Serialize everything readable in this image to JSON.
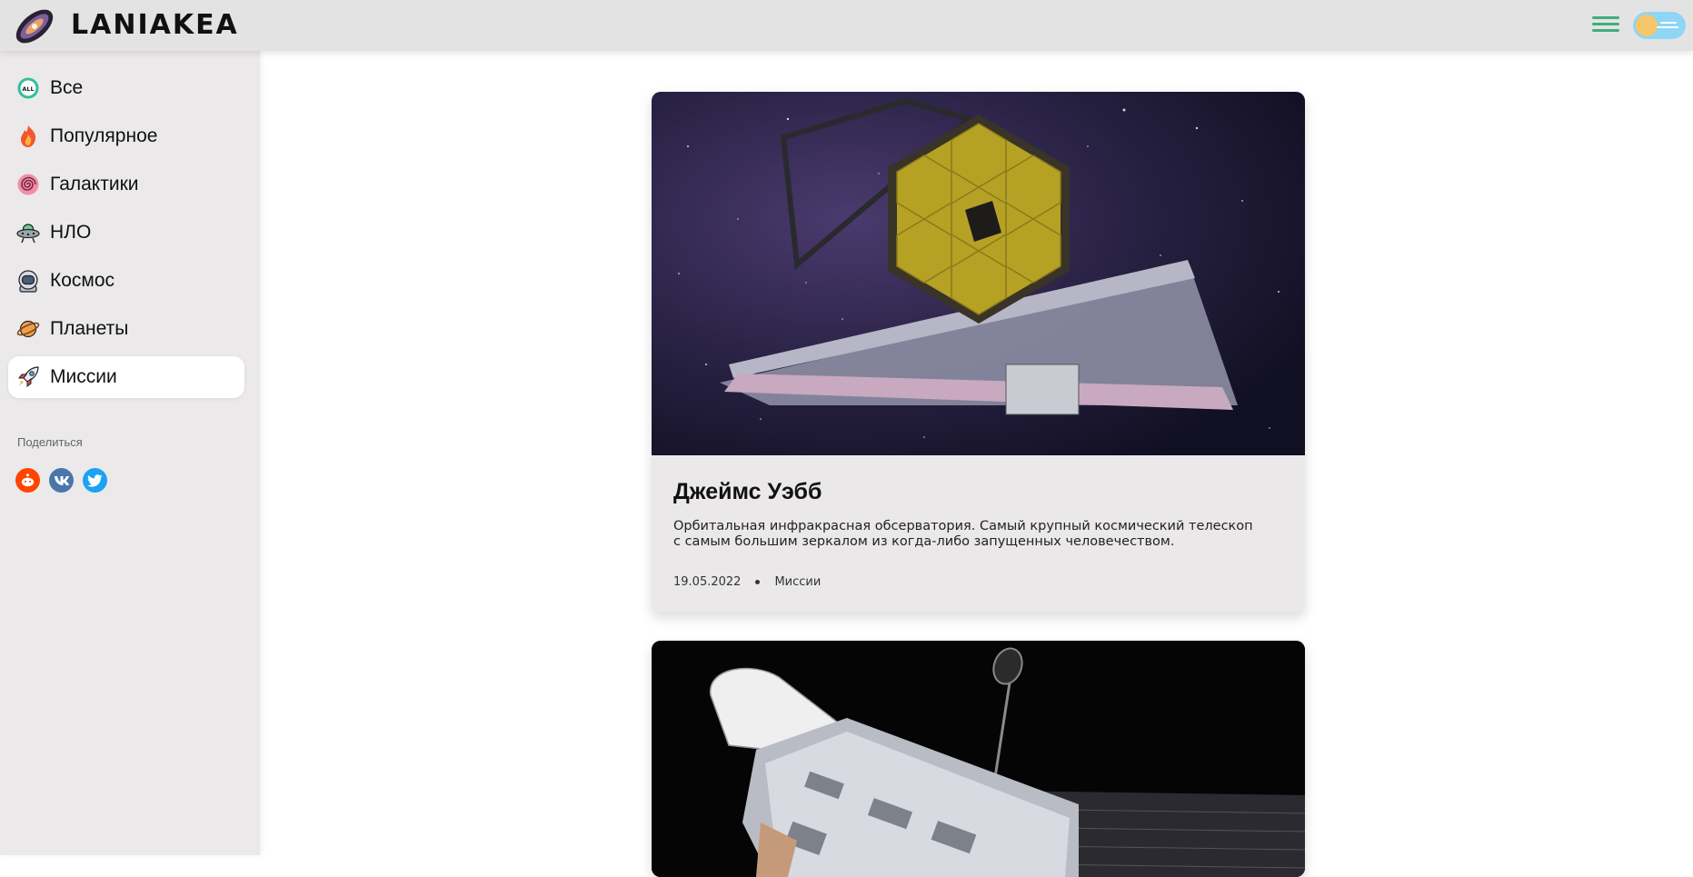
{
  "header": {
    "logo_text": "LANIAKEA",
    "logo_icon": "galaxy-icon",
    "menu_icon": "hamburger-menu-icon",
    "toggle_icon": "theme-toggle"
  },
  "sidebar": {
    "items": [
      {
        "label": "Все",
        "icon": "all-icon",
        "active": false
      },
      {
        "label": "Популярное",
        "icon": "fire-icon",
        "active": false
      },
      {
        "label": "Галактики",
        "icon": "spiral-galaxy-icon",
        "active": false
      },
      {
        "label": "НЛО",
        "icon": "ufo-icon",
        "active": false
      },
      {
        "label": "Космос",
        "icon": "astronaut-icon",
        "active": false
      },
      {
        "label": "Планеты",
        "icon": "planet-icon",
        "active": false
      },
      {
        "label": "Миссии",
        "icon": "rocket-icon",
        "active": true
      }
    ],
    "share_title": "Поделиться",
    "share": [
      {
        "icon": "reddit-icon",
        "color": "#ff4500"
      },
      {
        "icon": "vk-icon",
        "color": "#4a76a8"
      },
      {
        "icon": "twitter-icon",
        "color": "#1da1f2"
      }
    ]
  },
  "posts": [
    {
      "title": "Джеймс Уэбб",
      "description": "Орбитальная инфракрасная обсерватория. Самый крупный космический телескоп с самым большим зеркалом из когда-либо запущенных человечеством.",
      "date": "19.05.2022",
      "category": "Миссии",
      "image": "james-webb-telescope-image"
    },
    {
      "image": "hubble-telescope-image"
    }
  ],
  "colors": {
    "header_bg": "#e4e3e4",
    "sidebar_bg": "#ebe9ea",
    "card_bg": "#eae8e9",
    "menu_accent": "#3fae7a",
    "toggle_bg": "#8fd6f4"
  }
}
